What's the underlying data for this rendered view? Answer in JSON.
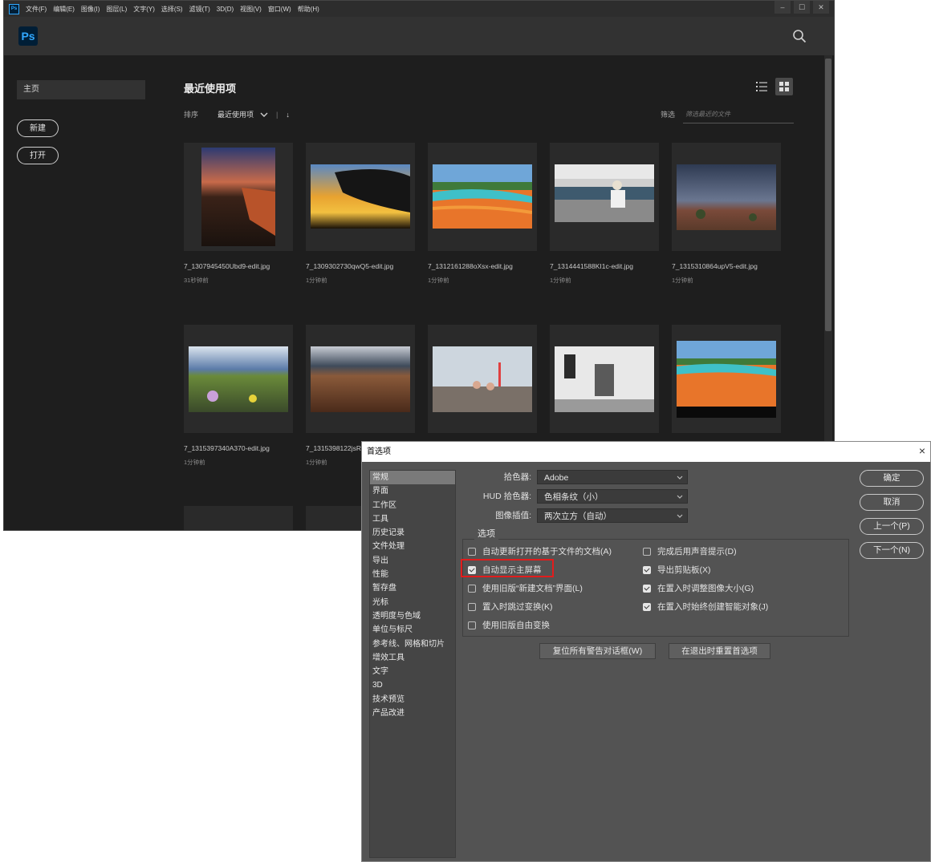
{
  "app": {
    "menu": [
      "文件(F)",
      "编辑(E)",
      "图像(I)",
      "图层(L)",
      "文字(Y)",
      "选择(S)",
      "滤镜(T)",
      "3D(D)",
      "视图(V)",
      "窗口(W)",
      "帮助(H)"
    ],
    "logo": "Ps",
    "mini_logo": "Ps",
    "window_controls": [
      "–",
      "☐",
      "✕"
    ]
  },
  "sidebar": {
    "home": "主页",
    "new_button": "新建",
    "open_button": "打开"
  },
  "recent": {
    "title": "最近使用项",
    "sort_label": "排序",
    "sort_value": "最近使用项",
    "sort_arrow": "↓",
    "filter_label": "筛选",
    "filter_placeholder": "筛选最近的文件",
    "files": [
      {
        "name": "7_1307945450Ubd9-edit.jpg",
        "time": "31秒钟前"
      },
      {
        "name": "7_1309302730qwQ5-edit.jpg",
        "time": "1分钟前"
      },
      {
        "name": "7_1312161288oXsx-edit.jpg",
        "time": "1分钟前"
      },
      {
        "name": "7_1314441588KI1c-edit.jpg",
        "time": "1分钟前"
      },
      {
        "name": "7_1315310864upV5-edit.jpg",
        "time": "1分钟前"
      },
      {
        "name": "7_1315397340A370-edit.jpg",
        "time": "1分钟前"
      },
      {
        "name": "7_1315398122jsR",
        "time": "1分钟前"
      }
    ]
  },
  "prefs": {
    "title": "首选项",
    "close": "×",
    "categories": [
      "常规",
      "界面",
      "工作区",
      "工具",
      "历史记录",
      "文件处理",
      "导出",
      "性能",
      "暂存盘",
      "光标",
      "透明度与色域",
      "单位与标尺",
      "参考线、网格和切片",
      "增效工具",
      "文字",
      "3D",
      "技术预览",
      "产品改进"
    ],
    "color_picker_label": "拾色器:",
    "color_picker_value": "Adobe",
    "hud_label": "HUD 拾色器:",
    "hud_value": "色相条纹（小）",
    "interp_label": "图像插值:",
    "interp_value": "两次立方（自动）",
    "options_legend": "选项",
    "options_left": [
      {
        "label": "自动更新打开的基于文件的文档(A)",
        "checked": false
      },
      {
        "label": "自动显示主屏幕",
        "checked": true
      },
      {
        "label": "使用旧版“新建文档”界面(L)",
        "checked": false
      },
      {
        "label": "置入时跳过变换(K)",
        "checked": false
      },
      {
        "label": "使用旧版自由变换",
        "checked": false
      }
    ],
    "options_right": [
      {
        "label": "完成后用声音提示(D)",
        "checked": false
      },
      {
        "label": "导出剪贴板(X)",
        "checked": true
      },
      {
        "label": "在置入时调整图像大小(G)",
        "checked": true
      },
      {
        "label": "在置入时始终创建智能对象(J)",
        "checked": true
      }
    ],
    "reset_warnings": "复位所有警告对话框(W)",
    "reset_on_quit": "在退出时重置首选项",
    "ok": "确定",
    "cancel": "取消",
    "prev": "上一个(P)",
    "next": "下一个(N)"
  }
}
